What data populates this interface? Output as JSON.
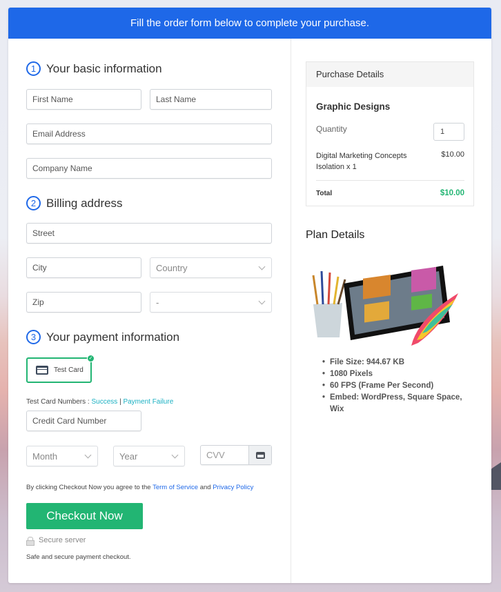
{
  "banner": {
    "text": "Fill the order form below to complete your purchase."
  },
  "sections": [
    {
      "number": "1",
      "title": "Your basic information"
    },
    {
      "number": "2",
      "title": "Billing address"
    },
    {
      "number": "3",
      "title": "Your payment information"
    }
  ],
  "basic_info": {
    "first_name_placeholder": "First Name",
    "last_name_placeholder": "Last Name",
    "email_placeholder": "Email Address",
    "company_placeholder": "Company Name"
  },
  "billing": {
    "street_placeholder": "Street",
    "city_placeholder": "City",
    "country_selected": "Country",
    "zip_placeholder": "Zip",
    "state_selected": "-"
  },
  "payment": {
    "method_label": "Test Card",
    "method_selected": true,
    "test_numbers_label": "Test Card Numbers :",
    "success_link": "Success",
    "separator": "|",
    "failure_link": "Payment Failure",
    "card_number_placeholder": "Credit Card Number",
    "month_selected": "Month",
    "year_selected": "Year",
    "cvv_placeholder": "CVV"
  },
  "agreement": {
    "prefix": "By clicking Checkout Now you agree to the",
    "tos_link": "Term of Service",
    "and": "and",
    "privacy_link": "Privacy Policy"
  },
  "checkout_button": "Checkout Now",
  "secure_server": "Secure server",
  "safe_text": "Safe and secure payment checkout.",
  "purchase_details": {
    "header": "Purchase Details",
    "product": "Graphic Designs",
    "quantity_label": "Quantity",
    "quantity_value": "1",
    "item_name": "Digital Marketing Concepts Isolation x 1",
    "item_price": "$10.00",
    "total_label": "Total",
    "total_value": "$10.00"
  },
  "plan_details": {
    "title": "Plan Details",
    "image_alt": "graphic design tablet with brushes and feather",
    "features": [
      "File Size: 944.67 KB",
      "1080 Pixels",
      "60 FPS (Frame Per Second)",
      "Embed: WordPress, Square Space, Wix"
    ]
  },
  "colors": {
    "brand_blue": "#1e68e8",
    "success_green": "#22b573",
    "link_teal": "#1ab0c2"
  }
}
